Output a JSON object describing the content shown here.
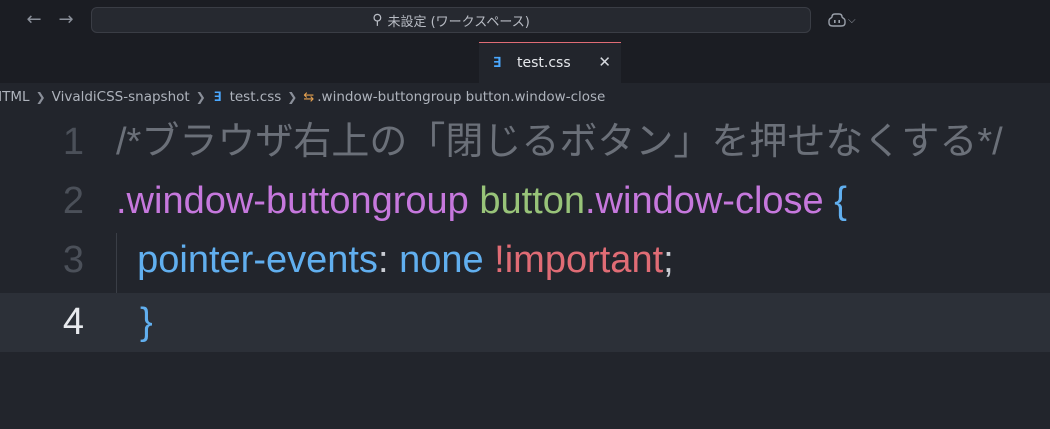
{
  "titlebar": {
    "back_icon": "←",
    "forward_icon": "→",
    "search_text": "未設定 (ワークスペース)",
    "copilot_icon": "copilot-icon"
  },
  "tab": {
    "icon": "∃",
    "label": "test.css",
    "close": "✕"
  },
  "breadcrumb": {
    "items": [
      "HTML",
      "VivaldiCSS-snapshot",
      "test.css",
      ".window-buttongroup button.window-close"
    ]
  },
  "editor": {
    "line_numbers": [
      "1",
      "2",
      "3",
      "4"
    ],
    "current_line": 4,
    "line1": {
      "comment": "/*ブラウザ右上の「閉じるボタン」を押せなくする*/"
    },
    "line2": {
      "selector1": ".window-buttongroup",
      "tag": "button",
      "selector2": ".window-close",
      "brace": "{"
    },
    "line3": {
      "indent": "  ",
      "property": "pointer-events",
      "colon": ":",
      "value": "none",
      "important": "!important",
      "semicolon": ";"
    },
    "line4": {
      "brace": "}"
    }
  },
  "colors": {
    "background": "#22252c",
    "comment": "#6b7079",
    "selector": "#c678dd",
    "tag": "#98c379",
    "brace": "#61afef",
    "important": "#e06c75",
    "tab_accent": "#e06c75"
  }
}
